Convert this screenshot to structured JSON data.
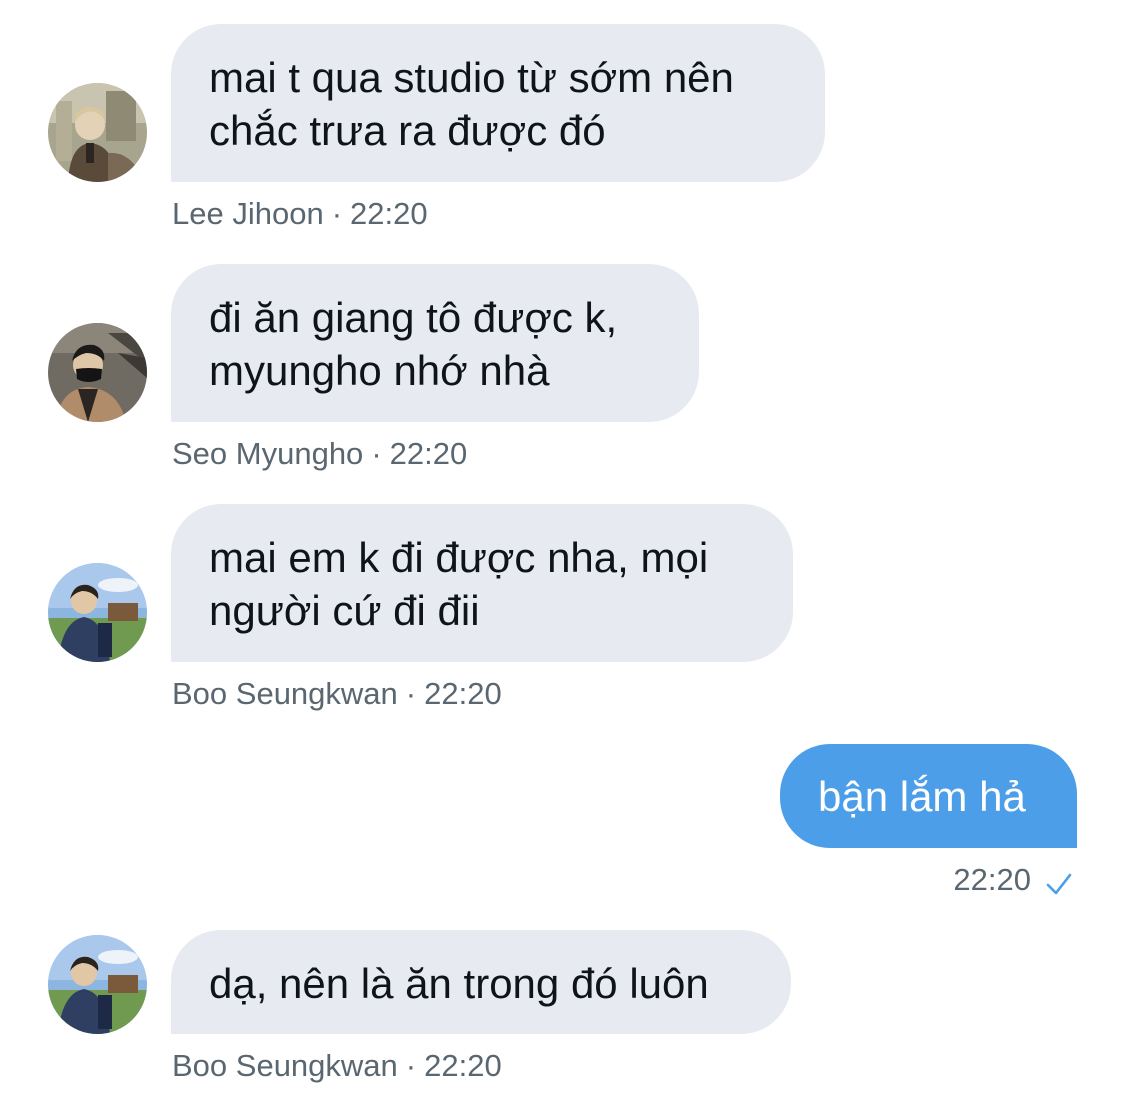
{
  "messages": [
    {
      "author": "Lee Jihoon",
      "time": "22:20",
      "lines": [
        "mai t qua studio từ sớm nên",
        "chắc trưa ra được đó"
      ],
      "avatar": "avatar-lee-jihoon"
    },
    {
      "author": "Seo Myungho",
      "time": "22:20",
      "lines": [
        "đi ăn giang tô được k,",
        "myungho nhớ nhà"
      ],
      "avatar": "avatar-seo-myungho"
    },
    {
      "author": "Boo Seungkwan",
      "time": "22:20",
      "lines": [
        "mai em k đi được nha, mọi",
        "người cứ đi đii"
      ],
      "avatar": "avatar-boo-seungkwan"
    },
    {
      "author": "Boo Seungkwan",
      "time": "22:20",
      "lines": [
        "dạ, nên là ăn trong đó luôn"
      ],
      "avatar": "avatar-boo-seungkwan"
    }
  ],
  "sent": {
    "text": "bận lắm hả",
    "time": "22:20",
    "status_icon": "check-icon"
  },
  "meta_separator": "·",
  "colors": {
    "incoming_bubble": "#e7ebf1",
    "outgoing_bubble": "#4c9ee8",
    "meta_text": "#5b6770",
    "check": "#4c9ee8"
  }
}
